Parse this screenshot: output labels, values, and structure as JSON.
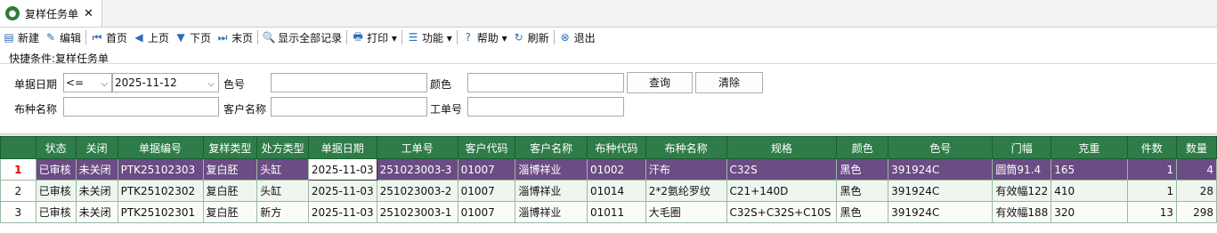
{
  "tab": {
    "label": "复样任务单",
    "close": "✕"
  },
  "toolbar": [
    {
      "name": "new-button",
      "icon": "new-doc-icon",
      "glyph": "▤",
      "label": "新建"
    },
    {
      "name": "edit-button",
      "icon": "edit-icon",
      "glyph": "✎",
      "label": "编辑"
    },
    {
      "sep": true
    },
    {
      "name": "first-page-button",
      "icon": "first-page-icon",
      "glyph": "⏮",
      "label": "首页"
    },
    {
      "name": "prev-page-button",
      "icon": "prev-page-icon",
      "glyph": "◀",
      "label": "上页"
    },
    {
      "name": "next-page-button",
      "icon": "next-page-icon",
      "glyph": "▼",
      "label": "下页"
    },
    {
      "name": "last-page-button",
      "icon": "last-page-icon",
      "glyph": "⏭",
      "label": "末页"
    },
    {
      "sep": true
    },
    {
      "name": "show-all-button",
      "icon": "search-doc-icon",
      "glyph": "🔍",
      "label": "显示全部记录"
    },
    {
      "sep": true
    },
    {
      "name": "print-button",
      "icon": "printer-icon",
      "glyph": "🖶",
      "label": "打印 ▾"
    },
    {
      "sep": true
    },
    {
      "name": "functions-button",
      "icon": "list-icon",
      "glyph": "☰",
      "label": "功能 ▾"
    },
    {
      "sep": true
    },
    {
      "name": "help-button",
      "icon": "help-icon",
      "glyph": "?",
      "label": "帮助 ▾"
    },
    {
      "name": "refresh-button",
      "icon": "refresh-icon",
      "glyph": "↻",
      "label": "刷新"
    },
    {
      "sep": true
    },
    {
      "name": "exit-button",
      "icon": "exit-icon",
      "glyph": "⊗",
      "label": "退出"
    }
  ],
  "query": {
    "title": "快捷条件:复样任务单",
    "date_label": "单据日期",
    "date_op": "<=",
    "date_value": "2025-11-12",
    "color_no_label": "色号",
    "color_label": "颜色",
    "search_btn": "查询",
    "clear_btn": "清除",
    "fabric_label": "布种名称",
    "customer_label": "客户名称",
    "work_no_label": "工单号"
  },
  "grid": {
    "headers": [
      "",
      "状态",
      "关闭",
      "单据编号",
      "复样类型",
      "处方类型",
      "单据日期",
      "工单号",
      "客户代码",
      "客户名称",
      "布种代码",
      "布种名称",
      "规格",
      "颜色",
      "色号",
      "门幅",
      "克重",
      "件数",
      "数量"
    ],
    "rows": [
      [
        "1",
        "已审核",
        "未关闭",
        "PTK25102303",
        "复白胚",
        "头缸",
        "2025-11-03",
        "251023003-3",
        "01007",
        "淄博祥业",
        "01002",
        "汗布",
        "C32S",
        "黑色",
        "391924C",
        "圆筒91.4",
        "165",
        "1",
        "4"
      ],
      [
        "2",
        "已审核",
        "未关闭",
        "PTK25102302",
        "复白胚",
        "头缸",
        "2025-11-03",
        "251023003-2",
        "01007",
        "淄博祥业",
        "01014",
        "2*2氨纶罗纹",
        "C21+140D",
        "黑色",
        "391924C",
        "有效幅122",
        "410",
        "1",
        "28"
      ],
      [
        "3",
        "已审核",
        "未关闭",
        "PTK25102301",
        "复白胚",
        "新方",
        "2025-11-03",
        "251023003-1",
        "01007",
        "淄博祥业",
        "01011",
        "大毛圈",
        "C32S+C32S+C10S",
        "黑色",
        "391924C",
        "有效幅188",
        "320",
        "13",
        "298"
      ]
    ]
  }
}
